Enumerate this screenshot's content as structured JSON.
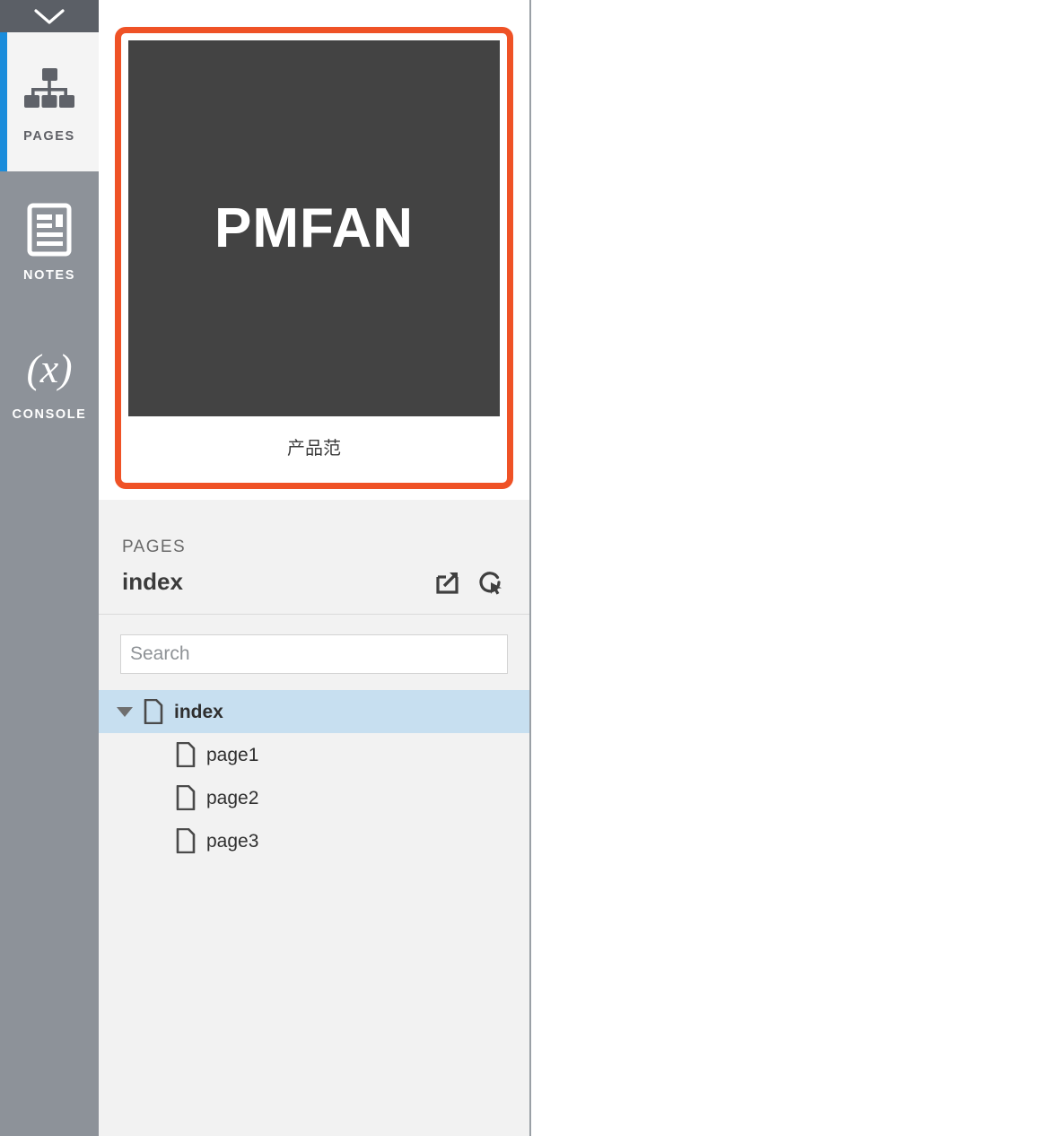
{
  "rail": {
    "collapse_icon": "chevron-down-icon",
    "items": [
      {
        "id": "pages",
        "label": "PAGES",
        "icon": "sitemap-icon",
        "active": true
      },
      {
        "id": "notes",
        "label": "NOTES",
        "icon": "document-icon",
        "active": false
      },
      {
        "id": "console",
        "label": "CONSOLE",
        "icon": "fx-icon",
        "active": false,
        "glyph": "(x)"
      }
    ]
  },
  "preview_card": {
    "thumbnail_text": "PMFAN",
    "caption": "产品范",
    "border_color": "#ef5226",
    "thumbnail_color": "#434343"
  },
  "panel": {
    "eyebrow": "PAGES",
    "title": "index",
    "actions": [
      {
        "id": "open-external",
        "icon": "external-link-icon"
      },
      {
        "id": "interact-preview",
        "icon": "cursor-refresh-icon"
      }
    ]
  },
  "search": {
    "value": "",
    "placeholder": "Search"
  },
  "tree": {
    "root": {
      "label": "index",
      "icon": "page-icon",
      "selected": true,
      "expanded": true
    },
    "children": [
      {
        "label": "page1",
        "icon": "page-icon"
      },
      {
        "label": "page2",
        "icon": "page-icon"
      },
      {
        "label": "page3",
        "icon": "page-icon"
      }
    ]
  },
  "colors": {
    "rail_bg": "#8d9299",
    "rail_top_bg": "#5b5f66",
    "active_accent": "#1a8cdb",
    "panel_bg": "#f2f2f2",
    "selection_bg": "#c7dff0",
    "accent_orange": "#ef5226"
  }
}
